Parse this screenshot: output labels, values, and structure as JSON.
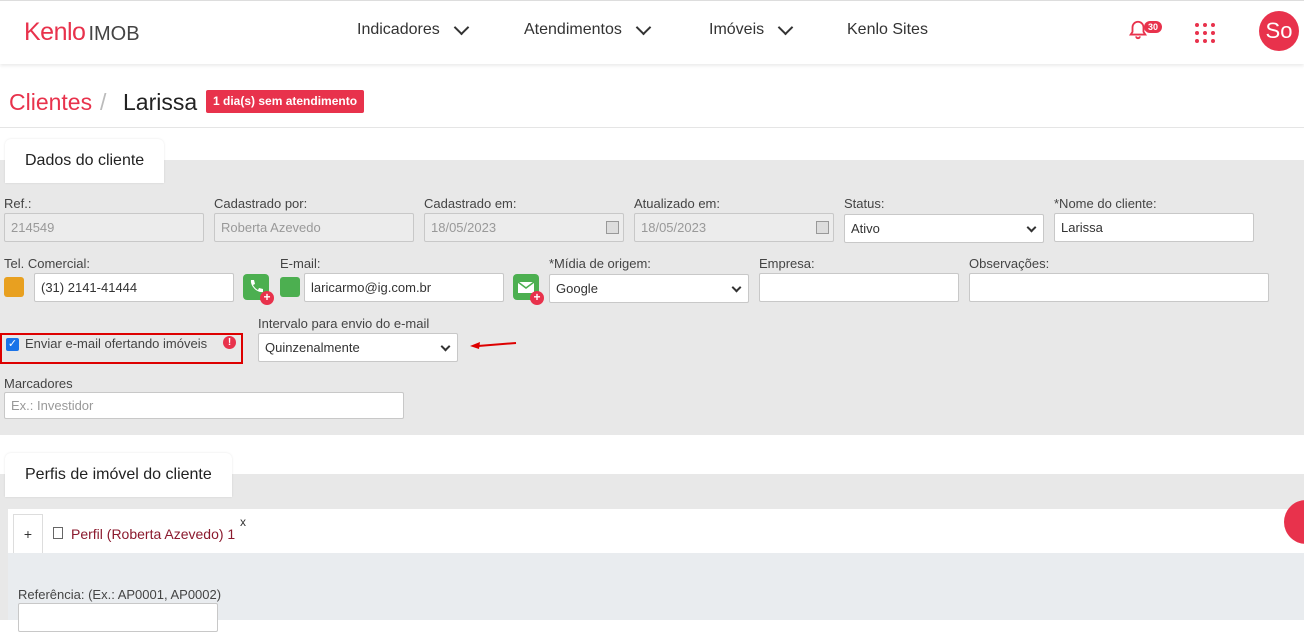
{
  "brand": {
    "name": "Kenlo",
    "suffix": "IMOB"
  },
  "nav": [
    {
      "label": "Indicadores",
      "dropdown": true
    },
    {
      "label": "Atendimentos",
      "dropdown": true
    },
    {
      "label": "Imóveis",
      "dropdown": true
    },
    {
      "label": "Kenlo Sites",
      "dropdown": false
    }
  ],
  "header": {
    "notifications_count": "30",
    "avatar_initials": "So",
    "accent": "#e8324c"
  },
  "breadcrumb": {
    "parent": "Clientes",
    "separator": "/",
    "current": "Larissa",
    "badge": "1 dia(s) sem atendimento"
  },
  "dados": {
    "tab_label": "Dados do cliente",
    "ref": {
      "label": "Ref.:",
      "value": "214549"
    },
    "cadastrado_por": {
      "label": "Cadastrado por:",
      "value": "Roberta Azevedo"
    },
    "cadastrado_em": {
      "label": "Cadastrado em:",
      "value": "18/05/2023"
    },
    "atualizado_em": {
      "label": "Atualizado em:",
      "value": "18/05/2023"
    },
    "status": {
      "label": "Status:",
      "value": "Ativo"
    },
    "nome": {
      "label": "*Nome do cliente:",
      "value": "Larissa"
    },
    "tel": {
      "label": "Tel. Comercial:",
      "value": "(31) 2141-41444"
    },
    "email": {
      "label": "E-mail:",
      "value": "laricarmo@ig.com.br"
    },
    "midia": {
      "label": "*Mídia de origem:",
      "value": "Google"
    },
    "empresa": {
      "label": "Empresa:",
      "value": ""
    },
    "observacoes": {
      "label": "Observações:",
      "value": ""
    },
    "enviar_email": {
      "label": "Enviar e-mail ofertando imóveis",
      "checked": true
    },
    "intervalo": {
      "label": "Intervalo para envio do e-mail",
      "value": "Quinzenalmente"
    },
    "marcadores": {
      "label": "Marcadores",
      "placeholder": "Ex.: Investidor"
    }
  },
  "perfis": {
    "tab_label": "Perfis de imóvel do cliente",
    "add_symbol": "+",
    "profile_tab": "Perfil (Roberta Azevedo) 1",
    "close_symbol": "x",
    "referencia_label": "Referência: (Ex.: AP0001, AP0002)"
  }
}
